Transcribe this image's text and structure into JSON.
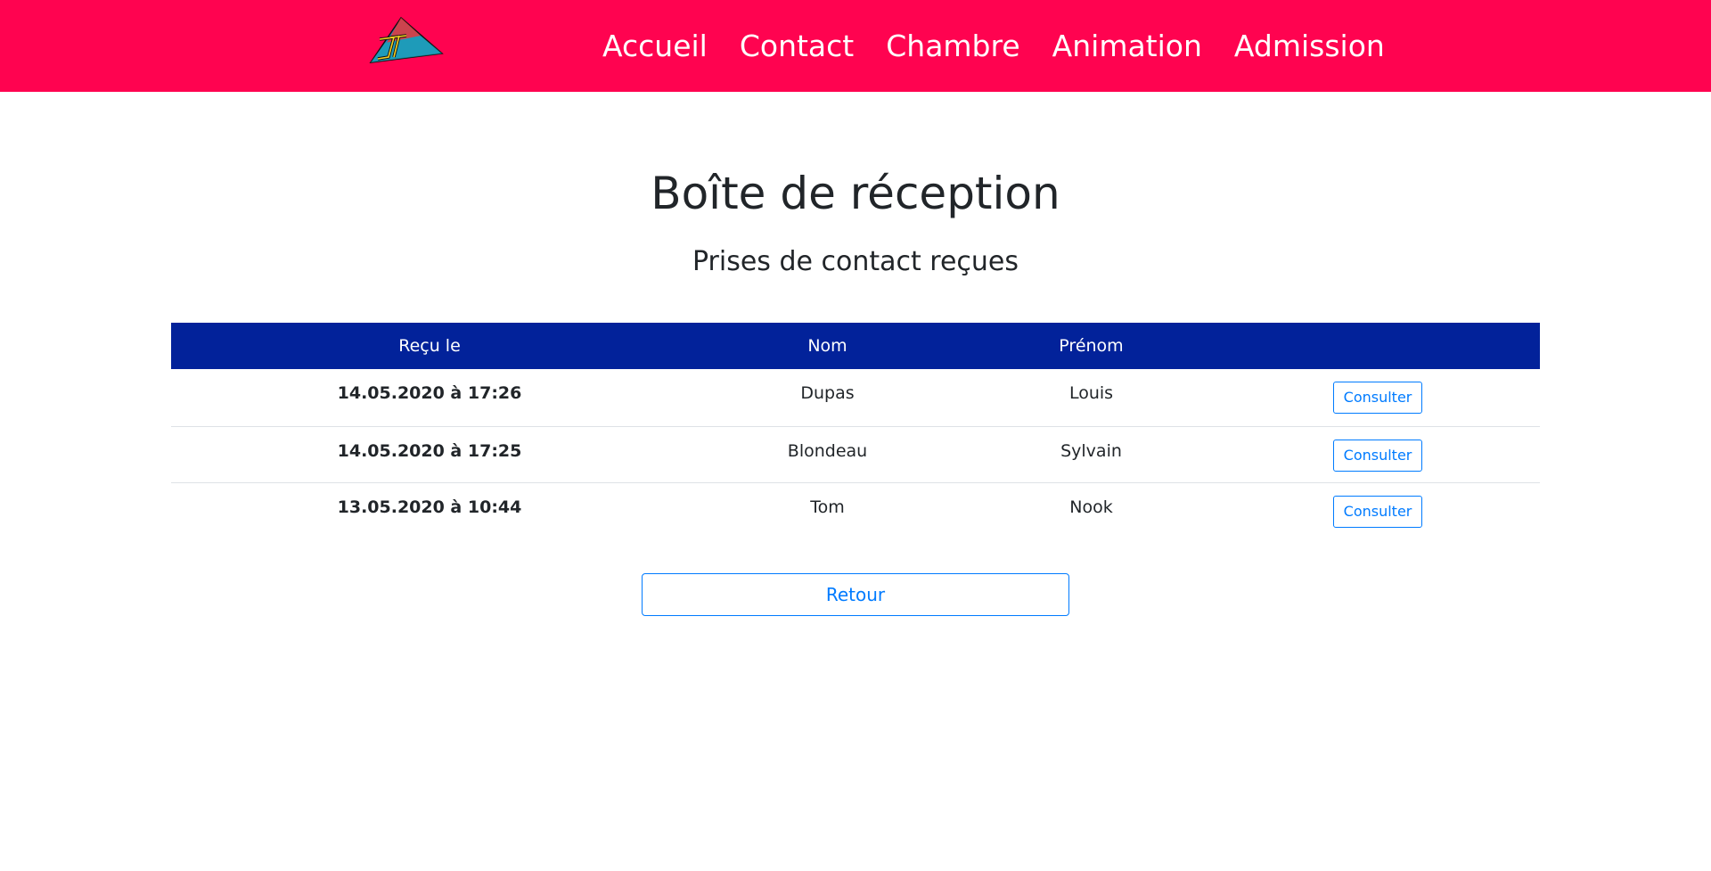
{
  "header": {
    "nav": [
      "Accueil",
      "Contact",
      "Chambre",
      "Animation",
      "Admission"
    ],
    "accent_color": "#ff0350"
  },
  "main": {
    "title": "Boîte de réception",
    "subtitle": "Prises de contact reçues"
  },
  "table": {
    "headers": [
      "Reçu le",
      "Nom",
      "Prénom",
      ""
    ],
    "header_color": "#02229a",
    "rows": [
      {
        "date": "14.05.2020 à 17:26",
        "nom": "Dupas",
        "prenom": "Louis",
        "action": "Consulter"
      },
      {
        "date": "14.05.2020 à 17:25",
        "nom": "Blondeau",
        "prenom": "Sylvain",
        "action": "Consulter"
      },
      {
        "date": "13.05.2020 à 10:44",
        "nom": "Tom",
        "prenom": "Nook",
        "action": "Consulter"
      }
    ]
  },
  "back_button": "Retour"
}
